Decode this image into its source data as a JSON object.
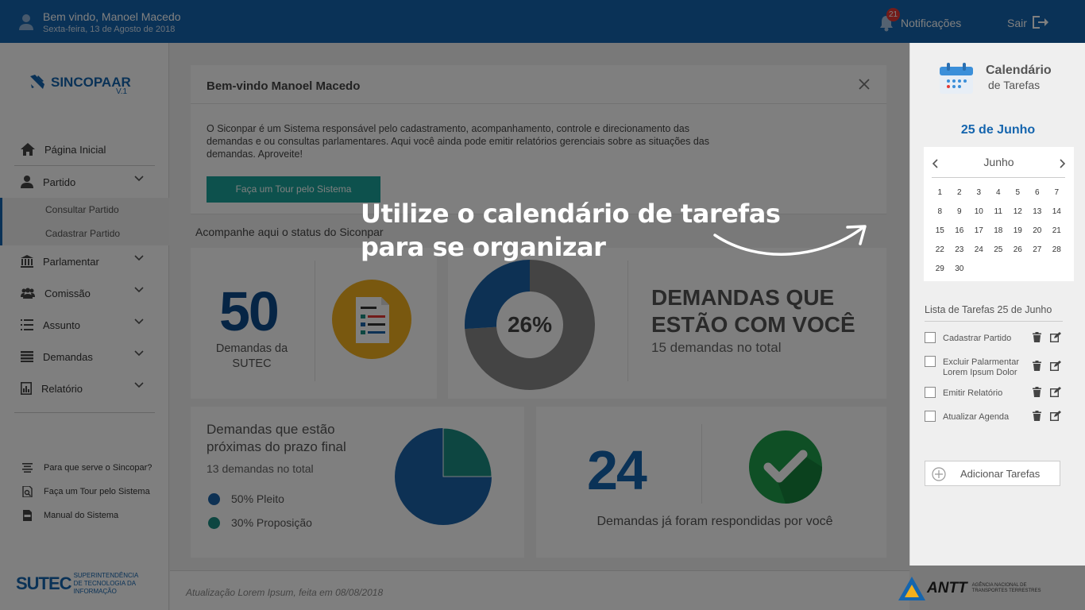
{
  "header": {
    "welcome": "Bem vindo, Manoel Macedo",
    "date": "Sexta-feira, 13 de Agosto de 2018",
    "notifications_label": "Notificações",
    "notifications_count": "21",
    "logout_label": "Sair"
  },
  "sidebar": {
    "logo_name": "SINCOPAAR",
    "logo_version": "V.1",
    "home": "Página Inicial",
    "items": [
      {
        "label": "Partido"
      },
      {
        "label": "Parlamentar"
      },
      {
        "label": "Comissão"
      },
      {
        "label": "Assunto"
      },
      {
        "label": "Demandas"
      },
      {
        "label": "Relatório"
      }
    ],
    "subitems": [
      "Consultar Partido",
      "Cadastrar Partido"
    ],
    "footer_links": [
      "Para que serve o Sincopar?",
      "Faça um Tour pelo Sistema",
      "Manual do Sistema"
    ],
    "sutec_big": "SUTEC",
    "sutec_small_1": "Superintendência",
    "sutec_small_2": "de Tecnologia da Informação"
  },
  "main": {
    "welcome_title": "Bem-vindo Manoel Macedo",
    "welcome_text": "O Siconpar é um Sistema responsável pelo cadastramento, acompanhamento, controle e direcionamento das demandas e ou consultas parlamentares. Aqui você ainda pode emitir relatórios gerenciais sobre as situações das demandas. Aproveite!",
    "tour_button": "Faça um Tour pelo Sistema",
    "status_label": "Acompanhe aqui o status do Siconpar",
    "sutec_demands_value": "50",
    "sutec_demands_label": "Demandas da SUTEC",
    "donut_percent": "26%",
    "donut_fraction": 0.26,
    "your_demands_title_1": "DEMANDAS QUE",
    "your_demands_title_2": "ESTÃO COM VOCÊ",
    "your_demands_total": "15 demandas no total",
    "deadline_title_1": "Demandas que estão",
    "deadline_title_2": "próximas do prazo final",
    "deadline_total": "13  demandas no total",
    "legend": [
      {
        "label": "50% Pleito",
        "color": "#1b63a8"
      },
      {
        "label": "30% Proposição",
        "color": "#1a8d83"
      }
    ],
    "pie_teal_fraction": 0.25,
    "answered_value": "24",
    "answered_label": "Demandas já foram respondidas por você"
  },
  "footer": {
    "update_text": "Atualização Lorem Ipsum, feita em 08/08/2018",
    "antt_word": "ANTT",
    "antt_sub_1": "Agência Nacional de",
    "antt_sub_2": "Transportes Terrestres"
  },
  "callout": {
    "line1": "Utilize o calendário de tarefas",
    "line2": "para se organizar"
  },
  "calendar": {
    "title_1": "Calendário",
    "title_2": "de Tarefas",
    "selected_date": "25 de Junho",
    "month": "Junho",
    "days": [
      "1",
      "2",
      "3",
      "4",
      "5",
      "6",
      "7",
      "8",
      "9",
      "10",
      "11",
      "12",
      "13",
      "14",
      "15",
      "16",
      "17",
      "18",
      "19",
      "20",
      "21",
      "22",
      "23",
      "24",
      "25",
      "26",
      "27",
      "28",
      "29",
      "30"
    ],
    "task_list_title": "Lista de Tarefas 25 de Junho",
    "tasks": [
      {
        "label": "Cadastrar Partido"
      },
      {
        "label": "Excluir Palarmentar Lorem Ipsum Dolor"
      },
      {
        "label": "Emitir Relatório"
      },
      {
        "label": "Atualizar Agenda"
      }
    ],
    "add_task": "Adicionar Tarefas"
  },
  "colors": {
    "brand": "#1565ae",
    "teal": "#1aa39a",
    "green": "#1e9e4a",
    "gold": "#f2b01e"
  }
}
